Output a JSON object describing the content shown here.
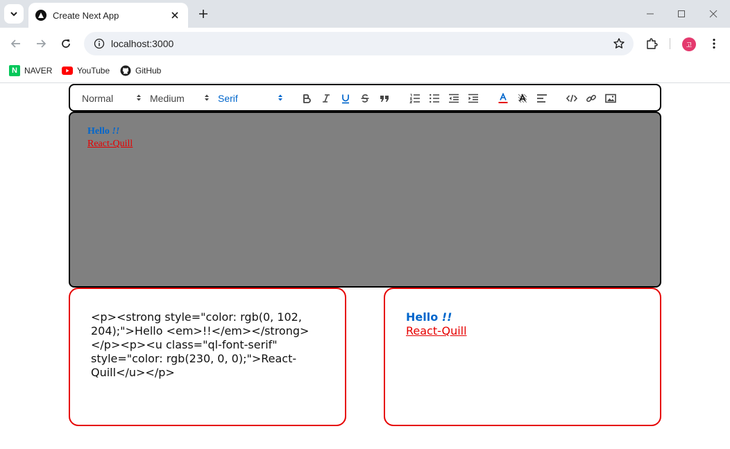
{
  "browser": {
    "tab": {
      "title": "Create Next App"
    },
    "address": {
      "url": "localhost:3000"
    },
    "profile_initial": "고",
    "bookmarks": [
      {
        "label": "NAVER",
        "icon": "naver-icon"
      },
      {
        "label": "YouTube",
        "icon": "youtube-icon"
      },
      {
        "label": "GitHub",
        "icon": "github-icon"
      }
    ]
  },
  "toolbar": {
    "header_picker": "Normal",
    "size_picker": "Medium",
    "font_picker": "Serif",
    "buttons": [
      "bold",
      "italic",
      "underline",
      "strike",
      "blockquote",
      "ordered-list",
      "bullet-list",
      "outdent",
      "indent",
      "color",
      "background",
      "align",
      "code-block",
      "link",
      "image"
    ]
  },
  "editor": {
    "line1": {
      "text": "Hello ",
      "em": "!!",
      "color": "#0066cc"
    },
    "line2": {
      "text": "React-Quill",
      "color": "#e60000"
    },
    "background": "#808080"
  },
  "html_output": {
    "code": "<p><strong style=\"color: rgb(0, 102, 204);\">Hello <em>!!</em></strong></p><p><u class=\"ql-font-serif\" style=\"color: rgb(230, 0, 0);\">React-Quill</u></p>"
  },
  "preview": {
    "line1": {
      "text": "Hello ",
      "em": "!!"
    },
    "line2": {
      "text": "React-Quill"
    }
  },
  "colors": {
    "accent_blue": "#0066cc",
    "accent_red": "#e60000",
    "panel_border": "#e60000"
  }
}
